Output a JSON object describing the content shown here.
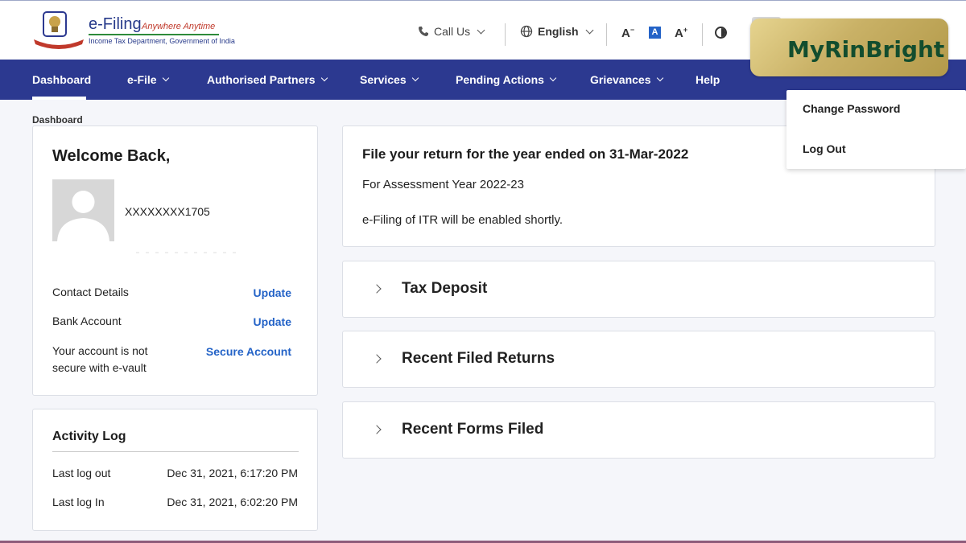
{
  "header": {
    "logo_title": "e-Filing",
    "logo_tagline": "Anywhere Anytime",
    "logo_subtitle": "Income Tax Department, Government of India",
    "call_us": "Call Us",
    "language": "English",
    "font_decrease": "A",
    "font_default": "A",
    "font_increase": "A"
  },
  "nav": {
    "items": [
      {
        "label": "Dashboard"
      },
      {
        "label": "e-File"
      },
      {
        "label": "Authorised Partners"
      },
      {
        "label": "Services"
      },
      {
        "label": "Pending Actions"
      },
      {
        "label": "Grievances"
      },
      {
        "label": "Help"
      }
    ]
  },
  "breadcrumb": "Dashboard",
  "profile": {
    "welcome": "Welcome Back,",
    "user_id": "XXXXXXXX1705",
    "rows": [
      {
        "label": "Contact Details",
        "action": "Update"
      },
      {
        "label": "Bank Account",
        "action": "Update"
      },
      {
        "label": "Your account is not secure with e-vault",
        "action": "Secure Account"
      }
    ]
  },
  "activity": {
    "title": "Activity Log",
    "rows": [
      {
        "label": "Last log out",
        "value": "Dec 31, 2021, 6:17:20 PM"
      },
      {
        "label": "Last log In",
        "value": "Dec 31, 2021, 6:02:20 PM"
      }
    ]
  },
  "file_return": {
    "title": "File your return for the year ended on 31-Mar-2022",
    "assessment_year": "For Assessment Year 2022-23",
    "note": "e-Filing of ITR will be enabled shortly."
  },
  "accordions": [
    {
      "label": "Tax Deposit"
    },
    {
      "label": "Recent Filed Returns"
    },
    {
      "label": "Recent Forms Filed"
    }
  ],
  "user_menu": {
    "items": [
      {
        "label": "Change Password"
      },
      {
        "label": "Log Out"
      }
    ]
  },
  "watermark": {
    "text": "MyRinBright"
  },
  "colors": {
    "nav_bg": "#2c3990",
    "link": "#2463c7",
    "page_bg": "#f5f6fa"
  }
}
